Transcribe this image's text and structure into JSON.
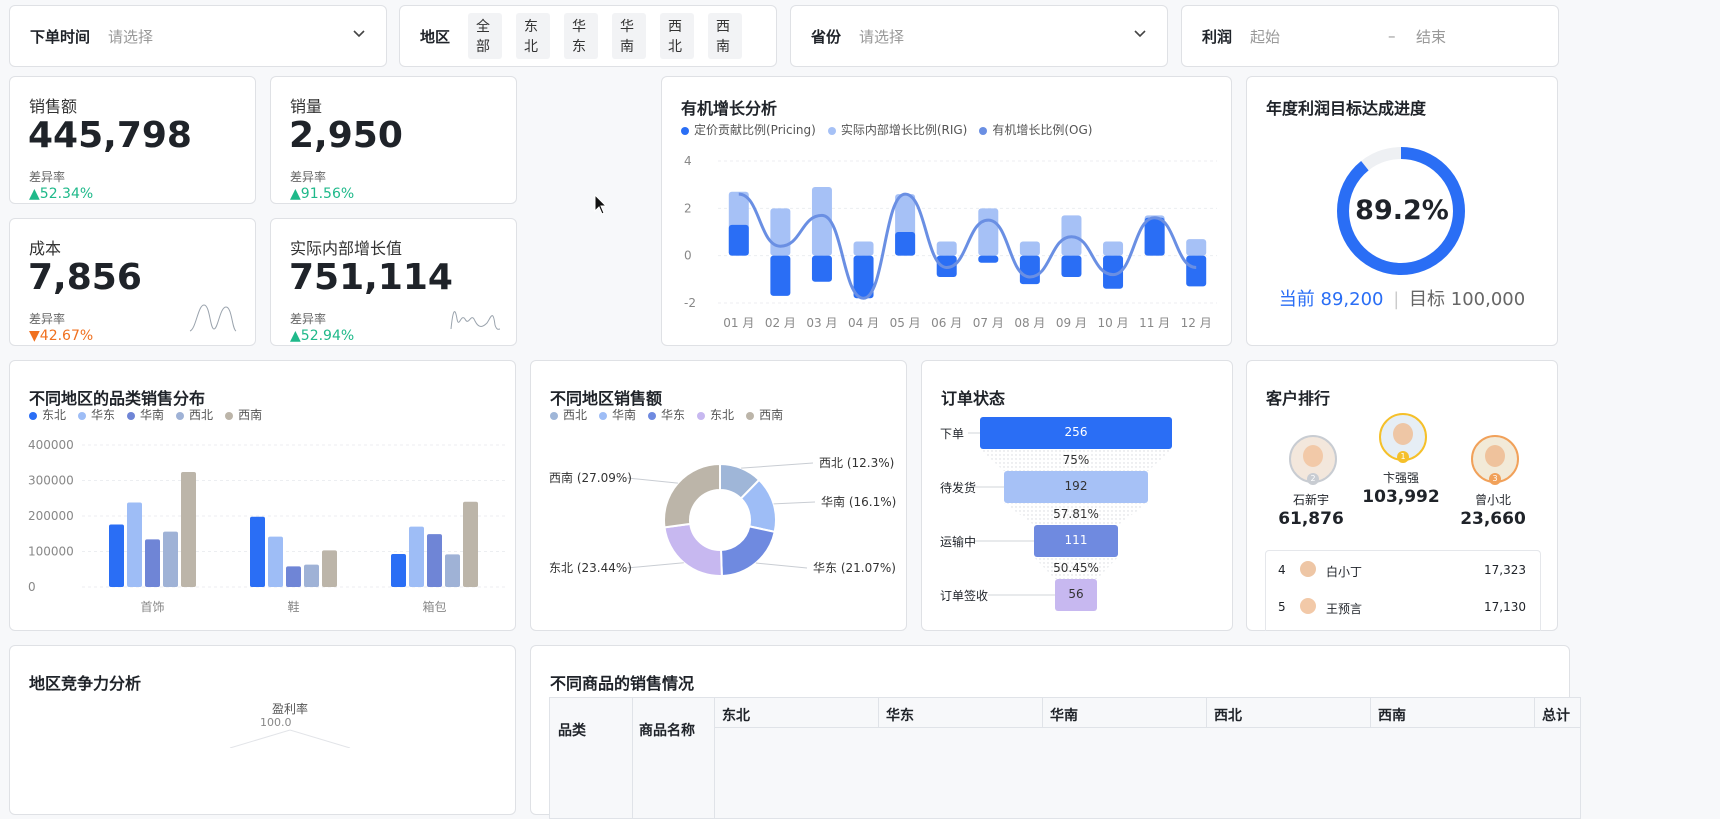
{
  "filters": {
    "order_time": {
      "label": "下单时间",
      "placeholder": "请选择"
    },
    "region": {
      "label": "地区",
      "tags": [
        "全部",
        "东北",
        "华东",
        "华南",
        "西北",
        "西南"
      ]
    },
    "province": {
      "label": "省份",
      "placeholder": "请选择"
    },
    "profit": {
      "label": "利润",
      "start": "起始",
      "sep": "–",
      "end": "结束"
    }
  },
  "kpis": [
    {
      "label": "销售额",
      "value": "445,798",
      "sub": "差异率",
      "rate": "52.34%",
      "dir": "up"
    },
    {
      "label": "销量",
      "value": "2,950",
      "sub": "差异率",
      "rate": "91.56%",
      "dir": "up"
    },
    {
      "label": "成本",
      "value": "7,856",
      "sub": "差异率",
      "rate": "42.67%",
      "dir": "down"
    },
    {
      "label": "实际内部增长值",
      "value": "751,114",
      "sub": "差异率",
      "rate": "52.94%",
      "dir": "up"
    }
  ],
  "growth": {
    "title": "有机增长分析",
    "legend": [
      "定价贡献比例(Pricing)",
      "实际内部增长比例(RIG)",
      "有机增长比例(OG)"
    ],
    "colors": [
      "#2a6ef5",
      "#a6c1f6",
      "#6a8fe3"
    ],
    "yticks": [
      "4",
      "2",
      "0",
      "-2"
    ]
  },
  "target": {
    "title": "年度利润目标达成进度",
    "percent": "89.2%",
    "progress": 0.892,
    "current": "当前 89,200",
    "goal": "目标 100,000"
  },
  "category_chart": {
    "title": "不同地区的品类销售分布",
    "colors": [
      "#2a6ef5",
      "#9ebdf6",
      "#6f85d6",
      "#9fb2d6",
      "#bcb5a9"
    ]
  },
  "donut": {
    "title": "不同地区销售额",
    "legend": [
      "西北",
      "华南",
      "华东",
      "东北",
      "西南"
    ],
    "colors": [
      "#9fb6d8",
      "#9ebdf6",
      "#6f8ae0",
      "#c7b8f0",
      "#bcb5a9"
    ]
  },
  "funnel": {
    "title": "订单状态",
    "stages": [
      {
        "name": "下单",
        "value": "256"
      },
      {
        "name": "待发货",
        "value": "192"
      },
      {
        "name": "运输中",
        "value": "111"
      },
      {
        "name": "订单签收",
        "value": "56"
      }
    ],
    "rates": [
      "75%",
      "57.81%",
      "50.45%"
    ]
  },
  "ranking": {
    "title": "客户排行",
    "top": [
      {
        "rank": "1",
        "name": "卞强强",
        "value": "103,992"
      },
      {
        "rank": "2",
        "name": "石新宇",
        "value": "61,876"
      },
      {
        "rank": "3",
        "name": "曾小北",
        "value": "23,660"
      }
    ],
    "list": [
      {
        "rank": "4",
        "name": "白小丁",
        "value": "17,323"
      },
      {
        "rank": "5",
        "name": "王预言",
        "value": "17,130"
      }
    ]
  },
  "radar": {
    "title": "地区竞争力分析",
    "axis_label": "盈利率",
    "axis_value": "100.0"
  },
  "product_table": {
    "title": "不同商品的销售情况",
    "headers": [
      "品类",
      "商品名称"
    ],
    "regions": [
      "东北",
      "华东",
      "华南",
      "西北",
      "西南",
      "总计"
    ]
  },
  "chart_data": [
    {
      "type": "bar",
      "title": "有机增长分析",
      "categories": [
        "01 月",
        "02 月",
        "03 月",
        "04 月",
        "05 月",
        "06 月",
        "07 月",
        "08 月",
        "09 月",
        "10 月",
        "11 月",
        "12 月"
      ],
      "ylim": [
        -2,
        4
      ],
      "series": [
        {
          "name": "定价贡献比例(Pricing)",
          "values": [
            1.3,
            -1.7,
            -1.1,
            -1.8,
            1.0,
            -0.9,
            -0.3,
            -1.2,
            -0.9,
            -1.4,
            1.6,
            -1.3
          ]
        },
        {
          "name": "实际内部增长比例(RIG)",
          "values": [
            2.7,
            2.0,
            2.9,
            0.6,
            2.6,
            0.6,
            2.0,
            0.6,
            1.7,
            0.6,
            1.7,
            0.7
          ]
        },
        {
          "name": "有机增长比例(OG)",
          "values": [
            2.6,
            0.4,
            1.7,
            -1.8,
            2.6,
            -0.5,
            1.5,
            -0.9,
            0.8,
            -0.8,
            1.6,
            -0.5
          ]
        }
      ]
    },
    {
      "type": "bar",
      "title": "不同地区的品类销售分布",
      "categories": [
        "首饰",
        "鞋",
        "箱包"
      ],
      "ylim": [
        0,
        400000
      ],
      "yticks": [
        "400000",
        "300000",
        "200000",
        "100000",
        "0"
      ],
      "series": [
        {
          "name": "东北",
          "values": [
            176000,
            198000,
            93000
          ]
        },
        {
          "name": "华东",
          "values": [
            238000,
            142000,
            170000
          ]
        },
        {
          "name": "华南",
          "values": [
            134000,
            58000,
            149000
          ]
        },
        {
          "name": "西北",
          "values": [
            156000,
            63000,
            92000
          ]
        },
        {
          "name": "西南",
          "values": [
            324000,
            103000,
            240000
          ]
        }
      ]
    },
    {
      "type": "pie",
      "title": "不同地区销售额",
      "slices": [
        {
          "name": "西北",
          "label": "西北 (12.3%)",
          "value": 12.3
        },
        {
          "name": "华南",
          "label": "华南 (16.1%)",
          "value": 16.1
        },
        {
          "name": "华东",
          "label": "华东 (21.07%)",
          "value": 21.07
        },
        {
          "name": "东北",
          "label": "东北 (23.44%)",
          "value": 23.44
        },
        {
          "name": "西南",
          "label": "西南 (27.09%)",
          "value": 27.09
        }
      ]
    }
  ]
}
